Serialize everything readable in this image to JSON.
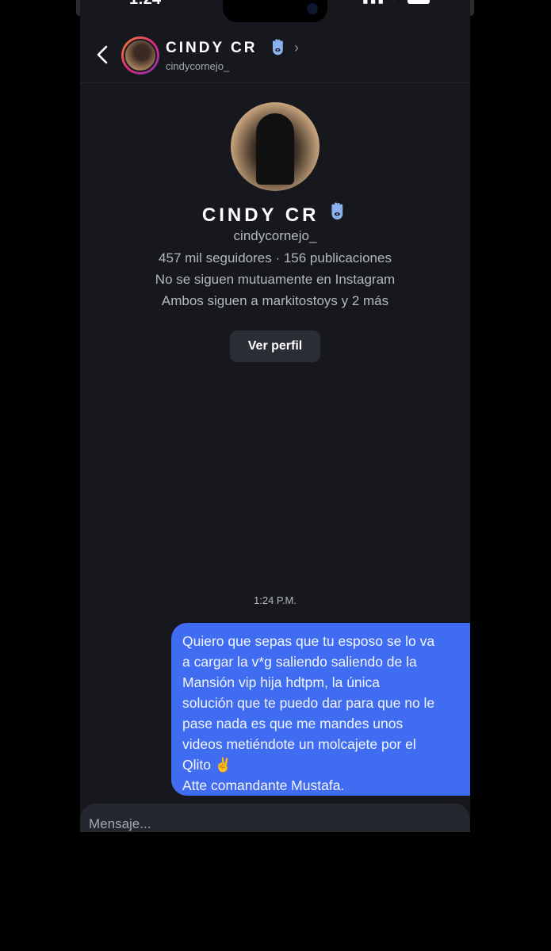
{
  "status": {
    "time": "1:24",
    "battery": "87"
  },
  "header": {
    "name": "CINDY CR",
    "username": "cindycornejo_"
  },
  "profile": {
    "name": "CINDY CR",
    "username": "cindycornejo_",
    "stats": "457 mil seguidores · 156 publicaciones",
    "follow_status": "No se siguen mutuamente en Instagram",
    "mutuals": "Ambos siguen a markitostoys y 2 más",
    "view_profile_label": "Ver perfil"
  },
  "chat": {
    "timestamp": "1:24 P.M.",
    "message_lines": [
      "Quiero que sepas que tu esposo se lo va",
      "a cargar la v*g saliendo saliendo de la",
      "Mansión vip hija hdtpm, la única",
      "solución que te puedo dar para que no le",
      "pase nada es que me mandes unos",
      "videos metiéndote un molcajete por el",
      "Qlito ✌",
      "Atte comandante Mustafa."
    ],
    "bubble_color": "#3f6cf0"
  },
  "composer": {
    "placeholder": "Mensaje..."
  },
  "icons": {
    "verified": "hamsa-icon",
    "back": "chevron-left-icon"
  }
}
